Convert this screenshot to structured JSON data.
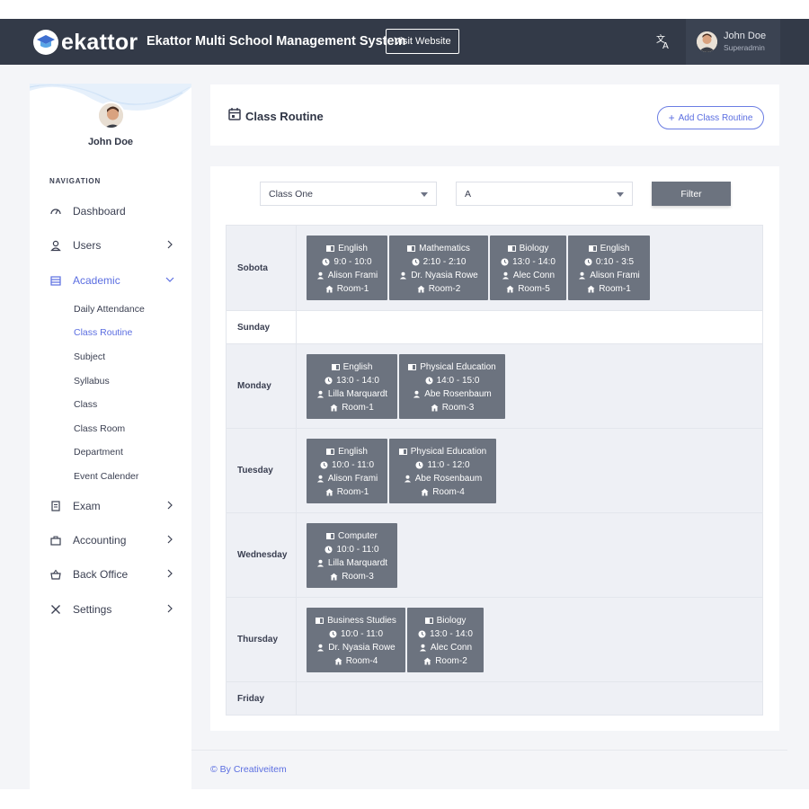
{
  "topbar": {
    "logo_text": "ekattor",
    "app_title": "Ekattor Multi School Management System",
    "visit_button": "Visit Website",
    "user_name": "John Doe",
    "user_role": "Superadmin"
  },
  "sidebar": {
    "profile_name": "John Doe",
    "nav_heading": "NAVIGATION",
    "items": [
      {
        "label": "Dashboard",
        "icon": "gauge-icon"
      },
      {
        "label": "Users",
        "icon": "user-icon"
      },
      {
        "label": "Academic",
        "icon": "school-icon"
      },
      {
        "label": "Exam",
        "icon": "clipboard-icon"
      },
      {
        "label": "Accounting",
        "icon": "briefcase-icon"
      },
      {
        "label": "Back Office",
        "icon": "basket-icon"
      },
      {
        "label": "Settings",
        "icon": "tools-icon"
      }
    ],
    "academic_sub": [
      "Daily Attendance",
      "Class Routine",
      "Subject",
      "Syllabus",
      "Class",
      "Class Room",
      "Department",
      "Event Calender"
    ]
  },
  "header": {
    "title": "Class Routine",
    "add_button": "Add Class Routine"
  },
  "filter": {
    "class_value": "Class One",
    "section_value": "A",
    "filter_button": "Filter"
  },
  "routine": [
    {
      "day": "Sobota",
      "classes": [
        {
          "subject": "English",
          "time": "9:0 - 10:0",
          "teacher": "Alison Frami",
          "room": "Room-1"
        },
        {
          "subject": "Mathematics",
          "time": "2:10 - 2:10",
          "teacher": "Dr. Nyasia Rowe",
          "room": "Room-2"
        },
        {
          "subject": "Biology",
          "time": "13:0 - 14:0",
          "teacher": "Alec Conn",
          "room": "Room-5"
        },
        {
          "subject": "English",
          "time": "0:10 - 3:5",
          "teacher": "Alison Frami",
          "room": "Room-1"
        }
      ]
    },
    {
      "day": "Sunday",
      "classes": []
    },
    {
      "day": "Monday",
      "classes": [
        {
          "subject": "English",
          "time": "13:0 - 14:0",
          "teacher": "Lilla Marquardt",
          "room": "Room-1"
        },
        {
          "subject": "Physical Education",
          "time": "14:0 - 15:0",
          "teacher": "Abe Rosenbaum",
          "room": "Room-3"
        }
      ]
    },
    {
      "day": "Tuesday",
      "classes": [
        {
          "subject": "English",
          "time": "10:0 - 11:0",
          "teacher": "Alison Frami",
          "room": "Room-1"
        },
        {
          "subject": "Physical Education",
          "time": "11:0 - 12:0",
          "teacher": "Abe Rosenbaum",
          "room": "Room-4"
        }
      ]
    },
    {
      "day": "Wednesday",
      "classes": [
        {
          "subject": "Computer",
          "time": "10:0 - 11:0",
          "teacher": "Lilla Marquardt",
          "room": "Room-3"
        }
      ]
    },
    {
      "day": "Thursday",
      "classes": [
        {
          "subject": "Business Studies",
          "time": "10:0 - 11:0",
          "teacher": "Dr. Nyasia Rowe",
          "room": "Room-4"
        },
        {
          "subject": "Biology",
          "time": "13:0 - 14:0",
          "teacher": "Alec Conn",
          "room": "Room-2"
        }
      ]
    },
    {
      "day": "Friday",
      "classes": []
    }
  ],
  "footer": {
    "text": "© By Creativeitem"
  },
  "colors": {
    "topbar": "#333a48",
    "accent": "#5b6ee1",
    "card": "#6c737f"
  }
}
